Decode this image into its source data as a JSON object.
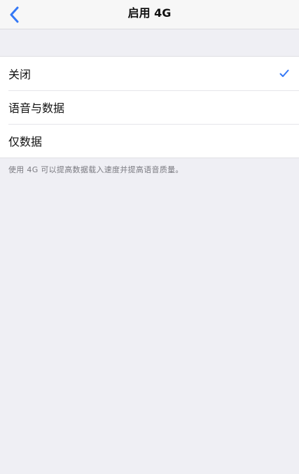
{
  "nav": {
    "title": "启用 4G",
    "back_icon": "chevron-left-icon",
    "accent_color": "#3478f6"
  },
  "options": [
    {
      "label": "关闭",
      "selected": true
    },
    {
      "label": "语音与数据",
      "selected": false
    },
    {
      "label": "仅数据",
      "selected": false
    }
  ],
  "footer": {
    "note": "使用 4G 可以提高数据载入速度并提高语音质量。"
  },
  "colors": {
    "background": "#efeff4",
    "checkmark": "#3478f6"
  }
}
